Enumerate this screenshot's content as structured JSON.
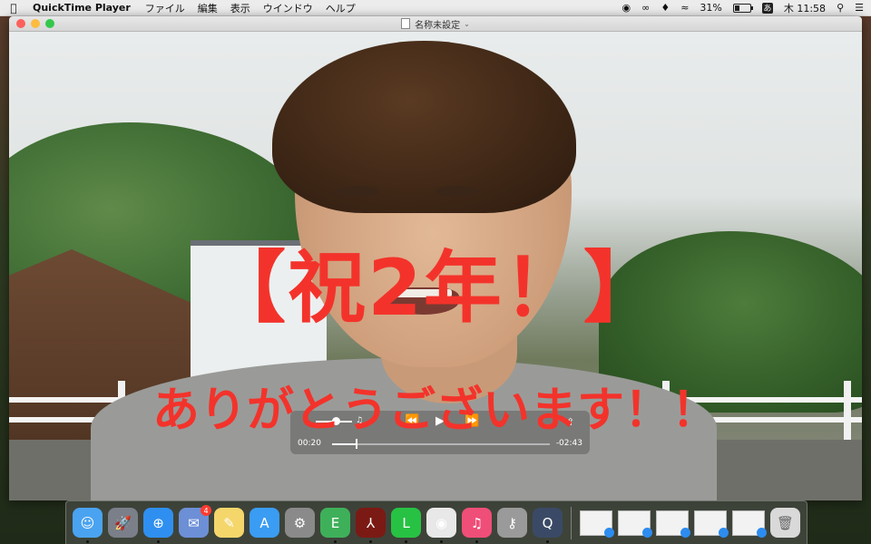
{
  "menubar": {
    "apple_icon": "apple-icon",
    "app_name": "QuickTime Player",
    "menus": [
      "ファイル",
      "編集",
      "表示",
      "ウインドウ",
      "ヘルプ"
    ],
    "status": {
      "battery_percent": "31%",
      "battery_level": 0.31,
      "ime": "あ",
      "clock": "木 11:58"
    }
  },
  "window": {
    "title": "名称未設定",
    "captions": {
      "main": "【祝2年！】",
      "sub": "ありがとうございます！！"
    },
    "player": {
      "elapsed": "00:20",
      "remaining": "-02:43",
      "progress": 0.11,
      "volume": 0.55
    }
  },
  "dock": {
    "apps": [
      {
        "name": "Finder",
        "icon": "finder-icon",
        "color": "#4aa3f0",
        "running": true
      },
      {
        "name": "Launchpad",
        "icon": "rocket-icon",
        "color": "#7a7f89",
        "running": false
      },
      {
        "name": "Safari",
        "icon": "compass-icon",
        "color": "#2f8ff0",
        "running": true
      },
      {
        "name": "Mail Pilot",
        "icon": "stamp-icon",
        "color": "#6c8fd6",
        "running": false,
        "badge": "4"
      },
      {
        "name": "Notes",
        "icon": "notes-icon",
        "color": "#f5d66b",
        "running": false
      },
      {
        "name": "App Store",
        "icon": "appstore-icon",
        "color": "#3a9cf2",
        "running": false
      },
      {
        "name": "System Preferences",
        "icon": "gear-icon",
        "color": "#8a8a8a",
        "running": false
      },
      {
        "name": "Evernote",
        "icon": "elephant-icon",
        "color": "#3fb05a",
        "running": true
      },
      {
        "name": "Adobe Acrobat",
        "icon": "acrobat-icon",
        "color": "#7b1a14",
        "running": true
      },
      {
        "name": "LINE",
        "icon": "line-icon",
        "color": "#27c243",
        "running": true
      },
      {
        "name": "Chrome",
        "icon": "chrome-icon",
        "color": "#e8e8e8",
        "running": true
      },
      {
        "name": "iTunes",
        "icon": "music-icon",
        "color": "#ef4e78",
        "running": true
      },
      {
        "name": "Keychain Access",
        "icon": "keys-icon",
        "color": "#9a9a9a",
        "running": false
      },
      {
        "name": "QuickTime Player",
        "icon": "quicktime-icon",
        "color": "#3a4a66",
        "running": true
      }
    ],
    "minimized": [
      "window-thumb-1",
      "window-thumb-2",
      "window-thumb-3",
      "window-thumb-4",
      "window-thumb-5"
    ],
    "trash": "trash-icon"
  }
}
